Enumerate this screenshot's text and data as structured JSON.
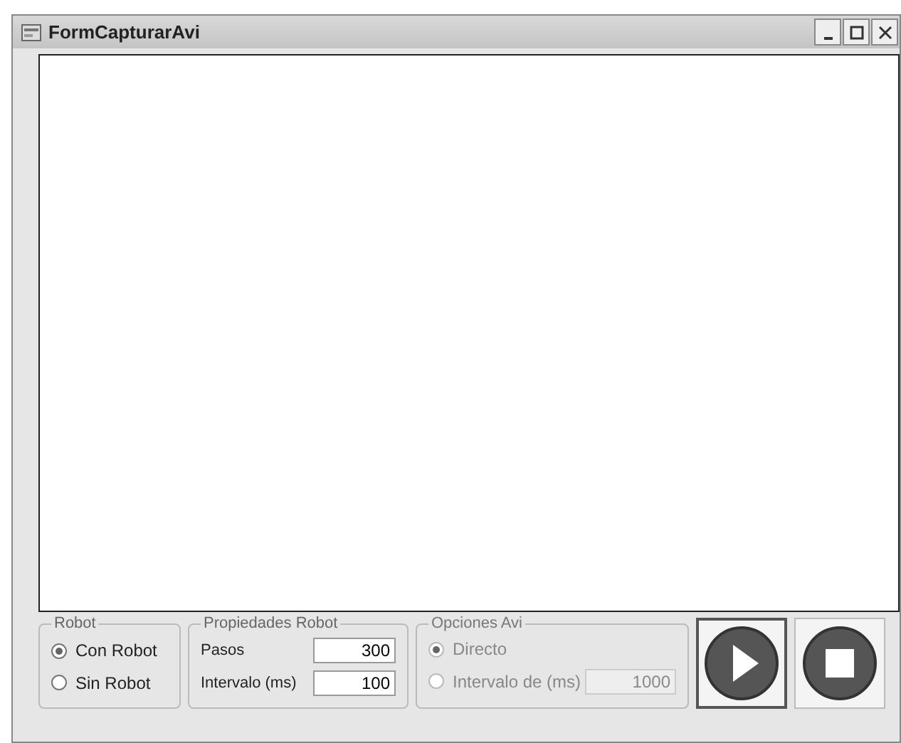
{
  "window": {
    "title": "FormCapturarAvi"
  },
  "robot_group": {
    "label": "Robot",
    "options": [
      {
        "label": "Con Robot",
        "selected": true
      },
      {
        "label": "Sin Robot",
        "selected": false
      }
    ]
  },
  "robot_properties": {
    "label": "Propiedades Robot",
    "fields": [
      {
        "label": "Pasos",
        "value": "300"
      },
      {
        "label": "Intervalo (ms)",
        "value": "100"
      }
    ]
  },
  "avi_options": {
    "label": "Opciones Avi",
    "disabled": true,
    "options": [
      {
        "label": "Directo",
        "selected": true
      },
      {
        "label": "Intervalo de (ms)",
        "selected": false
      }
    ],
    "interval_value": "1000"
  },
  "buttons": [
    {
      "kind": "play"
    },
    {
      "kind": "stop"
    }
  ]
}
